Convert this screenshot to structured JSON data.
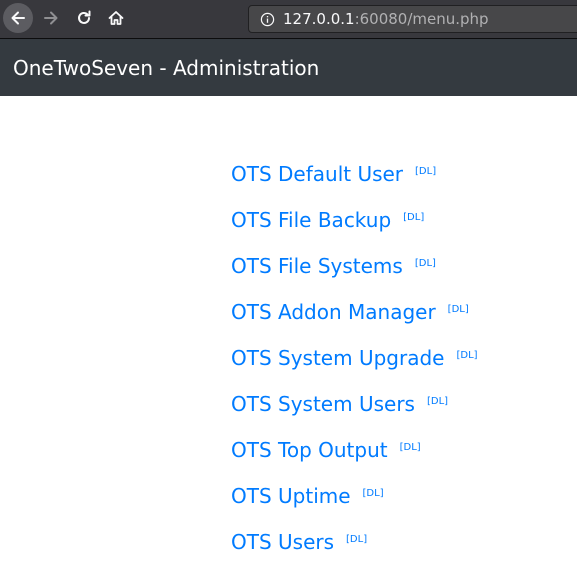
{
  "browser": {
    "url_host": "127.0.0.1",
    "url_rest": ":60080/menu.php",
    "icons": [
      "back-arrow-icon",
      "forward-arrow-icon",
      "reload-icon",
      "home-icon",
      "info-icon"
    ]
  },
  "navbar": {
    "brand": "OneTwoSeven - Administration"
  },
  "menu": {
    "dl_label": "[DL]",
    "items": [
      {
        "label": "OTS Default User",
        "dl": "[DL]"
      },
      {
        "label": "OTS File Backup",
        "dl": "[DL]"
      },
      {
        "label": "OTS File Systems",
        "dl": "[DL]"
      },
      {
        "label": "OTS Addon Manager",
        "dl": "[DL]"
      },
      {
        "label": "OTS System Upgrade",
        "dl": "[DL]"
      },
      {
        "label": "OTS System Users",
        "dl": "[DL]"
      },
      {
        "label": "OTS Top Output",
        "dl": "[DL]"
      },
      {
        "label": "OTS Uptime",
        "dl": "[DL]"
      },
      {
        "label": "OTS Users",
        "dl": "[DL]"
      }
    ]
  },
  "colors": {
    "link": "#007bff",
    "navbar_bg": "#343a40",
    "browser_bg": "#38383d"
  }
}
